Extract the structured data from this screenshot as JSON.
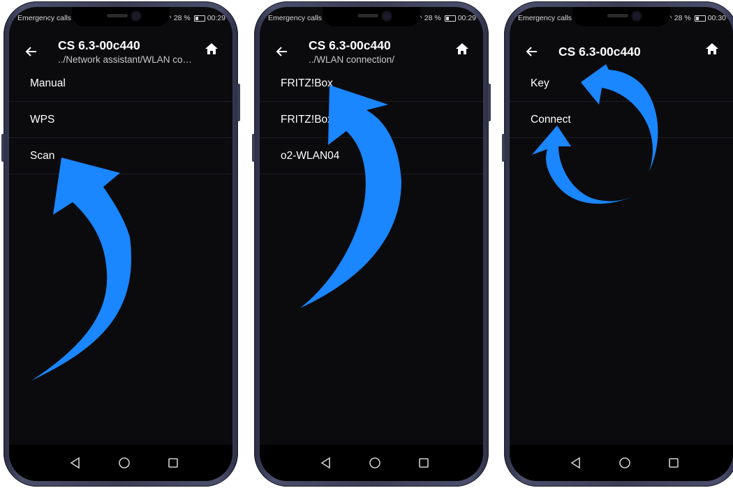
{
  "accent_color": "#1a86ff",
  "phones": [
    {
      "status": {
        "left": "Emergency calls only",
        "battery": "28 %",
        "time": "00:29"
      },
      "title": "CS 6.3-00c440",
      "subtitle": "../Network assistant/WLAN co…",
      "items": [
        "Manual",
        "WPS",
        "Scan"
      ]
    },
    {
      "status": {
        "left": "Emergency calls only",
        "battery": "28 %",
        "time": "00:29"
      },
      "title": "CS 6.3-00c440",
      "subtitle": "../WLAN connection/",
      "items": [
        "FRITZ!Box",
        "FRITZ!Box",
        "o2-WLAN04"
      ]
    },
    {
      "status": {
        "left": "Emergency calls only",
        "battery": "28 %",
        "time": "00:30"
      },
      "title": "CS 6.3-00c440",
      "subtitle": "",
      "items": [
        "Key",
        "Connect"
      ]
    }
  ],
  "icons": {
    "back": "arrow-left-icon",
    "home": "home-icon",
    "nav_back": "triangle-back-icon",
    "nav_home": "circle-home-icon",
    "nav_recents": "square-recents-icon"
  }
}
